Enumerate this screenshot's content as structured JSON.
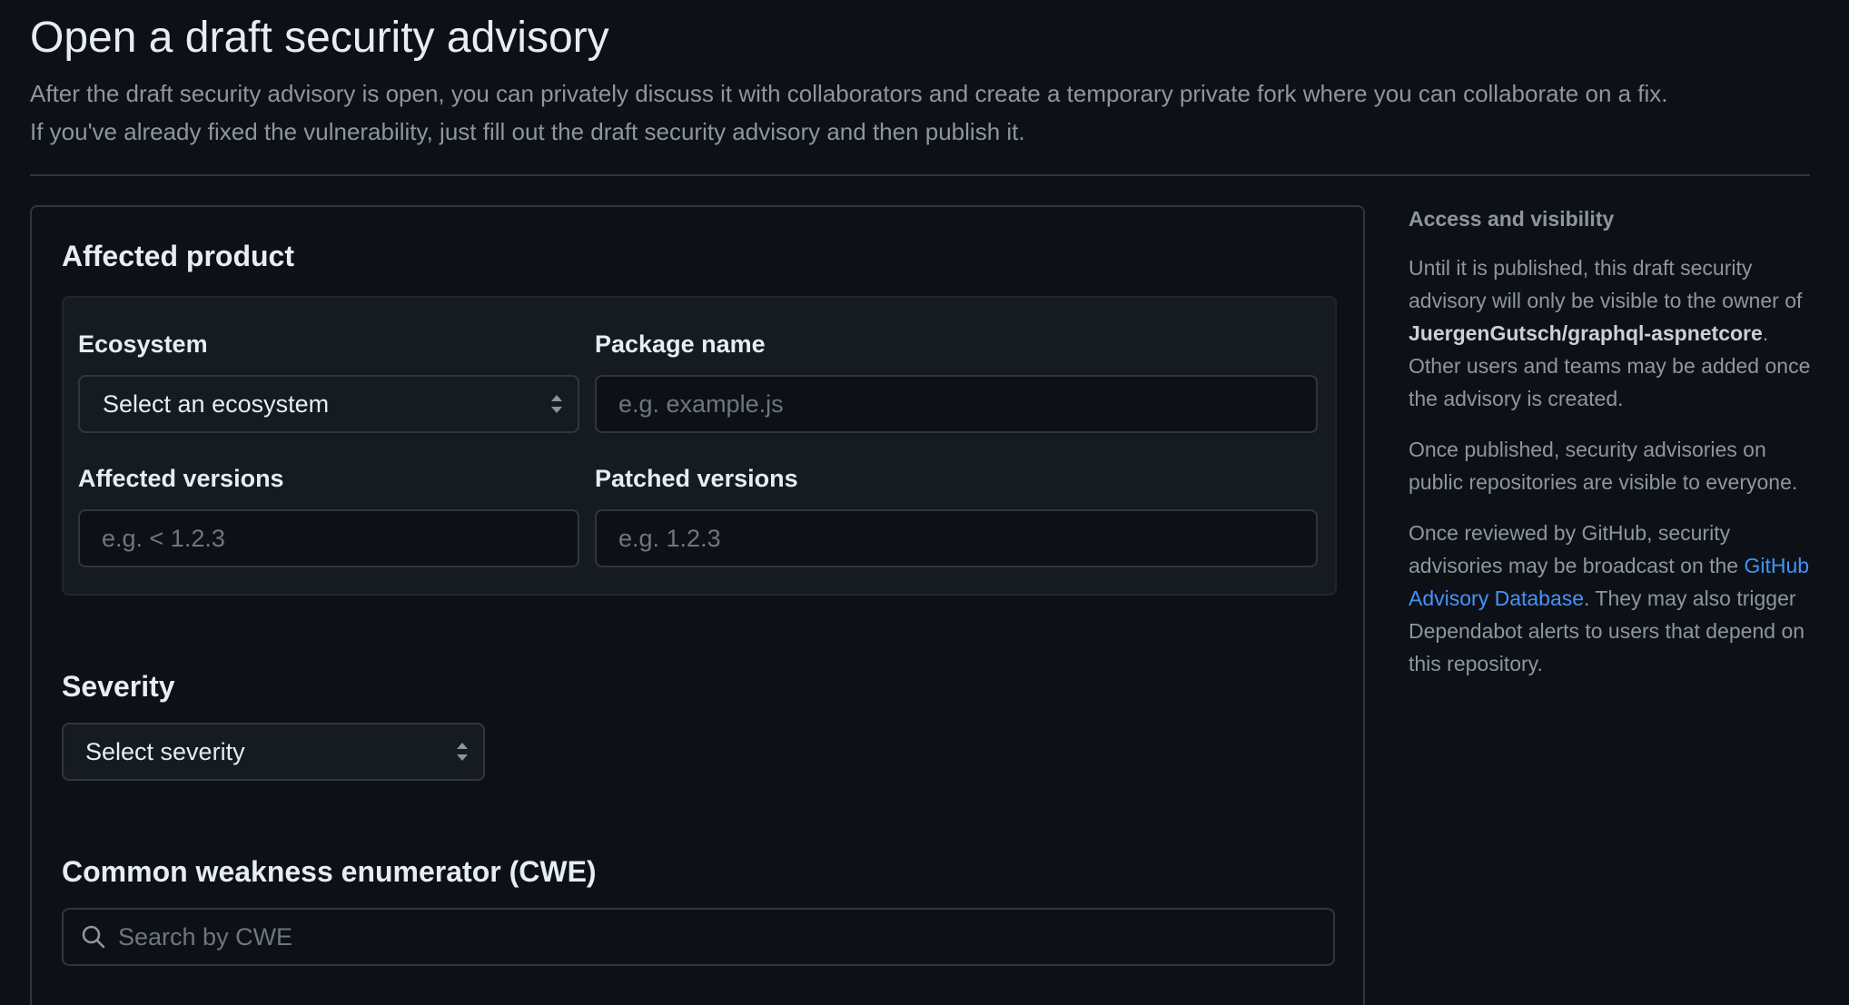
{
  "header": {
    "title": "Open a draft security advisory",
    "description_line1": "After the draft security advisory is open, you can privately discuss it with collaborators and create a temporary private fork where you can collaborate on a fix.",
    "description_line2": "If you've already fixed the vulnerability, just fill out the draft security advisory and then publish it."
  },
  "affected_product": {
    "title": "Affected product",
    "ecosystem_label": "Ecosystem",
    "ecosystem_value": "Select an ecosystem",
    "package_label": "Package name",
    "package_placeholder": "e.g. example.js",
    "affected_label": "Affected versions",
    "affected_placeholder": "e.g. < 1.2.3",
    "patched_label": "Patched versions",
    "patched_placeholder": "e.g. 1.2.3"
  },
  "severity": {
    "title": "Severity",
    "value": "Select severity"
  },
  "cwe": {
    "title": "Common weakness enumerator (CWE)",
    "placeholder": "Search by CWE"
  },
  "sidebar": {
    "title": "Access and visibility",
    "p1_before": "Until it is published, this draft security advisory will only be visible to the owner of ",
    "p1_repo": "JuergenGutsch/graphql-aspnetcore",
    "p1_after": ". Other users and teams may be added once the advisory is created.",
    "p2": "Once published, security advisories on public repositories are visible to everyone.",
    "p3_before": "Once reviewed by GitHub, security advisories may be broadcast on the ",
    "p3_link": "GitHub Advisory Database",
    "p3_after": ". They may also trigger Dependabot alerts to users that depend on this repository."
  }
}
